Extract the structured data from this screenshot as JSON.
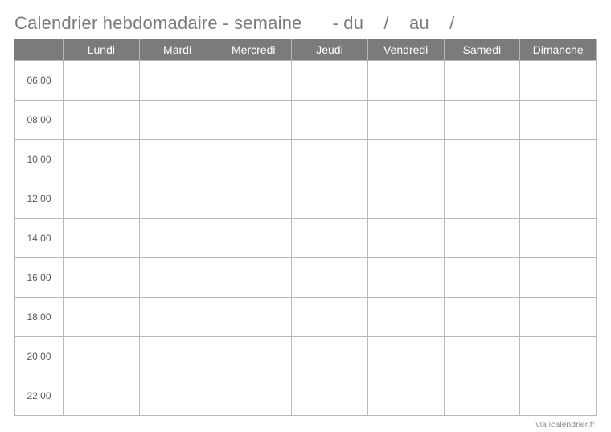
{
  "title": "Calendrier hebdomadaire - semaine      - du    /    au    /",
  "days": [
    "Lundi",
    "Mardi",
    "Mercredi",
    "Jeudi",
    "Vendredi",
    "Samedi",
    "Dimanche"
  ],
  "times": [
    "06:00",
    "08:00",
    "10:00",
    "12:00",
    "14:00",
    "16:00",
    "18:00",
    "20:00",
    "22:00"
  ],
  "credit": "via icalendrier.fr"
}
